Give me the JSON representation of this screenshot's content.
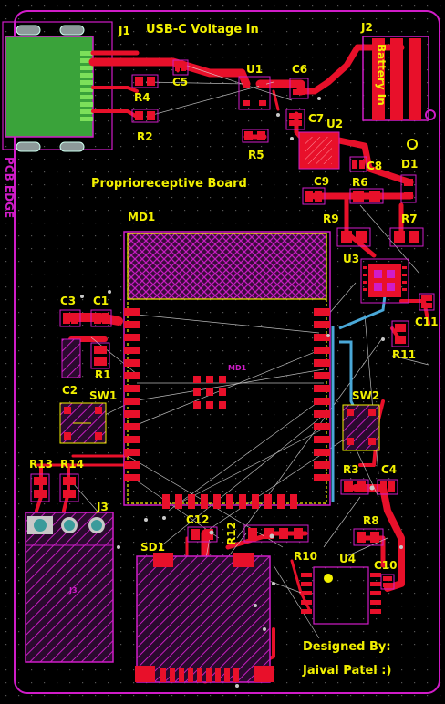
{
  "board": {
    "title_usbc": "USB-C Voltage In",
    "title_board": "Proprioreceptive Board",
    "designed_by": "Designed By:",
    "designer": "Jaival Patel :)",
    "edge_label": "PCB EDGE",
    "battery_label": "Battery In",
    "module_silk": "MD1",
    "j3_silk": "J3",
    "colors": {
      "background": "#000000",
      "copper": "#e8102a",
      "silk": "#f2f000",
      "courtyard": "#d01cc8",
      "usb_body": "#3aa33a",
      "pad_grey": "#c8c8c8",
      "trace_blue": "#4aa8d8",
      "ratsnest": "#d8d8d8"
    }
  },
  "designators": {
    "j1": "J1",
    "j2": "J2",
    "j3": "J3",
    "u1": "U1",
    "u2": "U2",
    "u3": "U3",
    "u4": "U4",
    "md1": "MD1",
    "sd1": "SD1",
    "sw1": "SW1",
    "sw2": "SW2",
    "d1": "D1",
    "c1": "C1",
    "c2": "C2",
    "c3": "C3",
    "c4": "C4",
    "c5": "C5",
    "c6": "C6",
    "c7": "C7",
    "c8": "C8",
    "c9": "C9",
    "c10": "C10",
    "c11": "C11",
    "c12": "C12",
    "r1": "R1",
    "r2": "R2",
    "r3": "R3",
    "r4": "R4",
    "r5": "R5",
    "r6": "R6",
    "r7": "R7",
    "r8": "R8",
    "r9": "R9",
    "r10": "R10",
    "r11": "R11",
    "r12": "R12",
    "r13": "R13",
    "r14": "R14"
  }
}
